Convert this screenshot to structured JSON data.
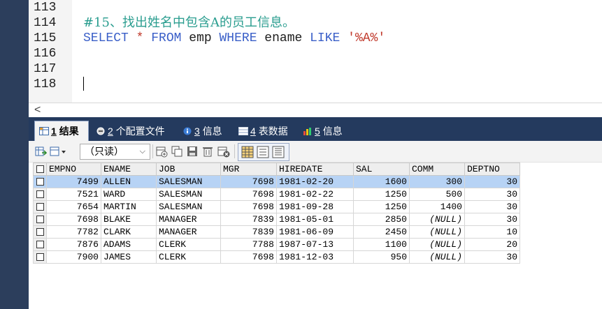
{
  "editor": {
    "lines": [
      {
        "num": "113",
        "segments": []
      },
      {
        "num": "114",
        "segments": [
          {
            "cls": "comment",
            "text": "#15、找出姓名中包含A的员工信息。"
          }
        ]
      },
      {
        "num": "115",
        "segments": [
          {
            "cls": "kw",
            "text": "SELECT"
          },
          {
            "cls": "plain",
            "text": " "
          },
          {
            "cls": "str",
            "text": "*"
          },
          {
            "cls": "plain",
            "text": " "
          },
          {
            "cls": "kw",
            "text": "FROM"
          },
          {
            "cls": "plain",
            "text": " emp "
          },
          {
            "cls": "kw",
            "text": "WHERE"
          },
          {
            "cls": "plain",
            "text": " ename "
          },
          {
            "cls": "kw",
            "text": "LIKE"
          },
          {
            "cls": "plain",
            "text": " "
          },
          {
            "cls": "str",
            "text": "'%A%'"
          }
        ]
      },
      {
        "num": "116",
        "segments": []
      },
      {
        "num": "117",
        "segments": []
      },
      {
        "num": "118",
        "segments": []
      }
    ]
  },
  "scroll": {
    "left_arrow": "<"
  },
  "tabs": [
    {
      "num": "1",
      "label": "结果",
      "icon": "result-grid-icon",
      "active": true
    },
    {
      "num": "2",
      "label": "个配置文件",
      "icon": "profile-icon",
      "active": false
    },
    {
      "num": "3",
      "label": "信息",
      "icon": "info-icon",
      "active": false
    },
    {
      "num": "4",
      "label": "表数据",
      "icon": "table-data-icon",
      "active": false
    },
    {
      "num": "5",
      "label": "信息",
      "icon": "info-chart-icon",
      "active": false
    }
  ],
  "toolbar": {
    "readonly_select": "（只读）",
    "icons": [
      "export-icon",
      "import-dropdown-icon",
      "insert-row-icon",
      "copy-row-icon",
      "save-icon",
      "delete-icon",
      "cancel-icon",
      "grid-view-icon",
      "form-view-icon",
      "text-view-icon"
    ]
  },
  "grid": {
    "columns": [
      "EMPNO",
      "ENAME",
      "JOB",
      "MGR",
      "HIREDATE",
      "SAL",
      "COMM",
      "DEPTNO"
    ],
    "rows": [
      [
        "7499",
        "ALLEN",
        "SALESMAN",
        "7698",
        "1981-02-20",
        "1600",
        "300",
        "30"
      ],
      [
        "7521",
        "WARD",
        "SALESMAN",
        "7698",
        "1981-02-22",
        "1250",
        "500",
        "30"
      ],
      [
        "7654",
        "MARTIN",
        "SALESMAN",
        "7698",
        "1981-09-28",
        "1250",
        "1400",
        "30"
      ],
      [
        "7698",
        "BLAKE",
        "MANAGER",
        "7839",
        "1981-05-01",
        "2850",
        "(NULL)",
        "30"
      ],
      [
        "7782",
        "CLARK",
        "MANAGER",
        "7839",
        "1981-06-09",
        "2450",
        "(NULL)",
        "10"
      ],
      [
        "7876",
        "ADAMS",
        "CLERK",
        "7788",
        "1987-07-13",
        "1100",
        "(NULL)",
        "20"
      ],
      [
        "7900",
        "JAMES",
        "CLERK",
        "7698",
        "1981-12-03",
        "950",
        "(NULL)",
        "30"
      ]
    ],
    "selected_row": 0
  },
  "colors": {
    "keyword": "#3a5fc8",
    "comment": "#2a9d8f",
    "string": "#c0392b",
    "tabbar": "#243a5e",
    "selection": "#b7d3f5"
  }
}
